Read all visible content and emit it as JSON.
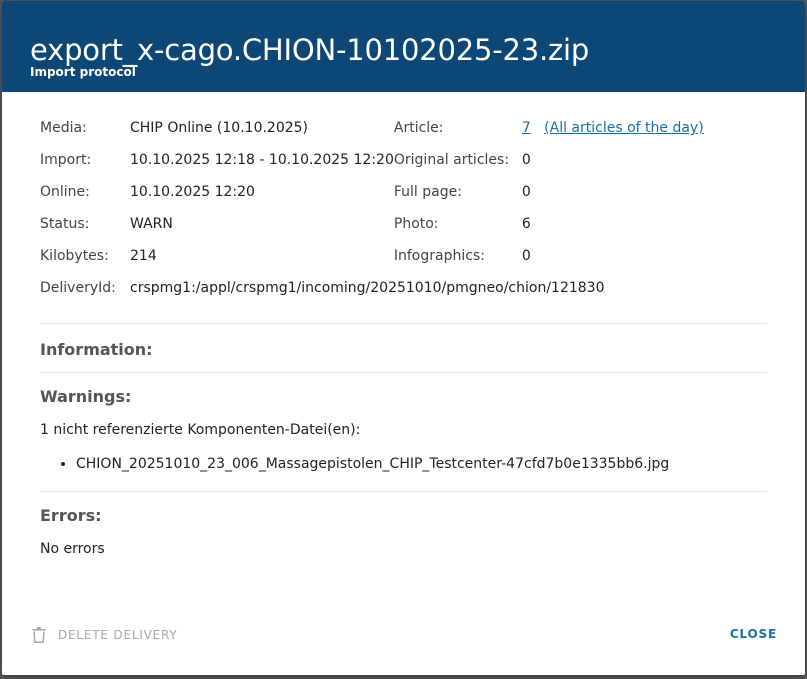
{
  "dialog": {
    "title": "export_x-cago.CHION-10102025-23.zip",
    "subtitle": "Import protocol"
  },
  "meta": {
    "media_label": "Media:",
    "media_value": "CHIP Online (10.10.2025)",
    "import_label": "Import:",
    "import_value": "10.10.2025 12:18 - 10.10.2025 12:20",
    "online_label": "Online:",
    "online_value": "10.10.2025 12:20",
    "status_label": "Status:",
    "status_value": "WARN",
    "kilobytes_label": "Kilobytes:",
    "kilobytes_value": "214",
    "deliveryid_label": "DeliveryId:",
    "deliveryid_value": "crspmg1:/appl/crspmg1/incoming/20251010/pmgneo/chion/121830",
    "article_label": "Article:",
    "article_value": "7",
    "article_link": "(All articles of the day)",
    "original_label": "Original articles:",
    "original_value": "0",
    "fullpage_label": "Full page:",
    "fullpage_value": "0",
    "photo_label": "Photo:",
    "photo_value": "6",
    "infographics_label": "Infographics:",
    "infographics_value": "0"
  },
  "information": {
    "title": "Information:"
  },
  "warnings": {
    "title": "Warnings:",
    "text": "1 nicht referenzierte Komponenten-Datei(en):",
    "items": [
      "CHION_20251010_23_006_Massagepistolen_CHIP_Testcenter-47cfd7b0e1335bb6.jpg"
    ]
  },
  "errors": {
    "title": "Errors:",
    "text": "No errors"
  },
  "footer": {
    "delete_label": "DELETE DELIVERY",
    "close_label": "CLOSE"
  },
  "colors": {
    "header_bg": "#0d4775",
    "link": "#1a6fa8",
    "disabled": "#a8a8a8"
  }
}
